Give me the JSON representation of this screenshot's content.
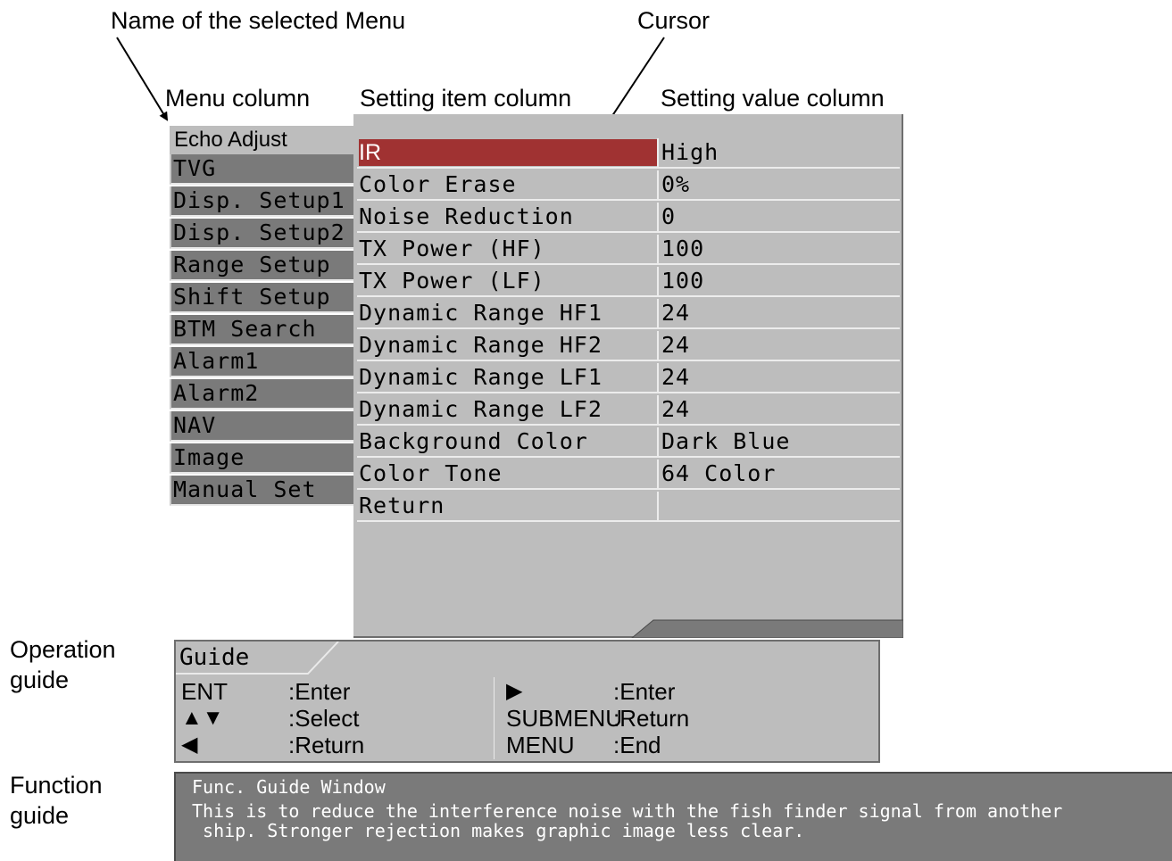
{
  "annotations": {
    "selected_menu_name": "Name of the selected Menu",
    "cursor": "Cursor",
    "menu_column": "Menu column",
    "setting_item_column": "Setting item column",
    "setting_value_column": "Setting value column",
    "operation_guide_line1": "Operation",
    "operation_guide_line2": "guide",
    "function_guide_line1": "Function",
    "function_guide_line2": "guide"
  },
  "menu": {
    "title": "Echo Adjust",
    "items": [
      "TVG",
      "Disp. Setup1",
      "Disp. Setup2",
      "Range Setup",
      "Shift Setup",
      "BTM Search",
      "Alarm1",
      "Alarm2",
      "NAV",
      "Image",
      "Manual Set"
    ]
  },
  "settings": [
    {
      "item": "IR",
      "value": "High",
      "selected": true
    },
    {
      "item": "Color Erase",
      "value": "0%"
    },
    {
      "item": "Noise Reduction",
      "value": "0"
    },
    {
      "item": "TX Power (HF)",
      "value": "100"
    },
    {
      "item": "TX Power (LF)",
      "value": "100"
    },
    {
      "item": "Dynamic Range HF1",
      "value": "24"
    },
    {
      "item": "Dynamic Range HF2",
      "value": "24"
    },
    {
      "item": "Dynamic Range LF1",
      "value": "24"
    },
    {
      "item": "Dynamic Range LF2",
      "value": "24"
    },
    {
      "item": "Background Color",
      "value": "Dark Blue"
    },
    {
      "item": "Color Tone",
      "value": "64 Color"
    },
    {
      "item": "Return",
      "value": ""
    }
  ],
  "guide": {
    "title": "Guide",
    "left": [
      {
        "key": "ENT",
        "action": ":Enter",
        "icon": "text"
      },
      {
        "key": "▲▼",
        "action": ":Select",
        "icon": "up-down-arrows-icon"
      },
      {
        "key": "◀",
        "action": ":Return",
        "icon": "left-arrow-icon"
      }
    ],
    "right": [
      {
        "key": "▶",
        "action": ":Enter",
        "icon": "right-arrow-icon"
      },
      {
        "key": "SUBMENU",
        "action": ":Return",
        "icon": "text"
      },
      {
        "key": "MENU",
        "action": ":End",
        "icon": "text"
      }
    ]
  },
  "function_guide": {
    "title": "Func. Guide Window",
    "line1": "This is to reduce the interference noise with the fish finder signal from another",
    "line2": " ship. Stronger rejection makes graphic image less clear."
  },
  "colors": {
    "cursor": "#a03232",
    "panel": "#bdbdbd",
    "menu_item": "#7a7a7a",
    "func_bg": "#7a7a7a"
  }
}
